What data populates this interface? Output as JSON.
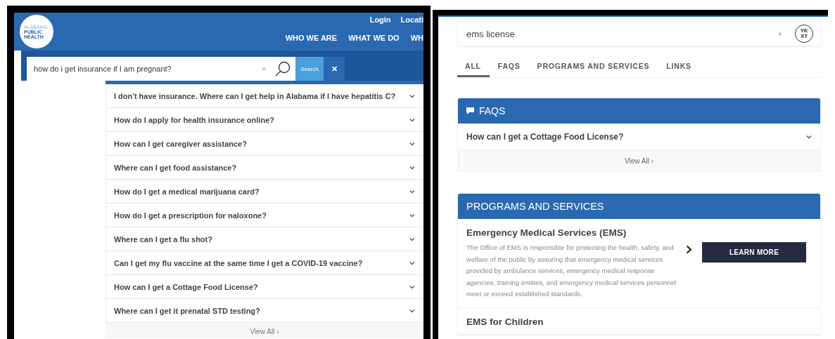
{
  "left_site": {
    "logo": [
      "ALABAMA",
      "PUBLIC",
      "HEALTH"
    ],
    "top_links": [
      "Login",
      "Locati"
    ],
    "nav": [
      "WHO WE ARE",
      "WHAT WE DO",
      "WH"
    ],
    "search": {
      "value": "how do i get insurance if I am pregnant?",
      "clear": "×",
      "button": "Search",
      "close": "✕"
    },
    "results": [
      {
        "question": "I don't have insurance. Where can I get help in Alabama if I have hepatitis C?",
        "expanded": false
      },
      {
        "question": "How do I apply for health insurance online?",
        "expanded": false
      },
      {
        "question": "How can I get caregiver assistance?",
        "expanded": false
      },
      {
        "question": "Where can I get food assistance?",
        "expanded": false
      },
      {
        "question": "How do I get a medical marijuana card?",
        "expanded": false
      },
      {
        "question": "How do I get a prescription for naloxone?",
        "expanded": false
      },
      {
        "question": "Where can I get a flu shot?",
        "expanded": false
      },
      {
        "question": "Can I get my flu vaccine at the same time I get a COVID-19 vaccine?",
        "expanded": false
      },
      {
        "question": "How can I get a Cottage Food License?",
        "expanded": false
      },
      {
        "question": "Where can I get it prenatal STD testing?",
        "expanded": false
      }
    ],
    "view_all": "View All ›"
  },
  "right_site": {
    "search": {
      "value": "ems license",
      "clear": "×",
      "logo": [
        "YE",
        "XT"
      ]
    },
    "tabs": [
      {
        "label": "ALL",
        "selected": true
      },
      {
        "label": "FAQS",
        "selected": false
      },
      {
        "label": "PROGRAMS AND SERVICES",
        "selected": false
      },
      {
        "label": "LINKS",
        "selected": false
      }
    ],
    "faqs": {
      "title": "FAQS",
      "items": [
        {
          "question": "How can I get a Cottage Food License?",
          "expanded": false
        }
      ],
      "view_all": "View All ›"
    },
    "programs": {
      "title": "PROGRAMS AND SERVICES",
      "items": [
        {
          "title": "Emergency Medical Services (EMS)",
          "description": "The Office of EMS is responsible for protecting the health, safety, and welfare of the public by assuring that emergency medical services provided by ambulance services, emergency medical response agencies, training entities, and emergency medical services personnel meet or exceed established standards.",
          "button": "LEARN MORE"
        },
        {
          "title": "EMS for Children"
        }
      ]
    }
  }
}
